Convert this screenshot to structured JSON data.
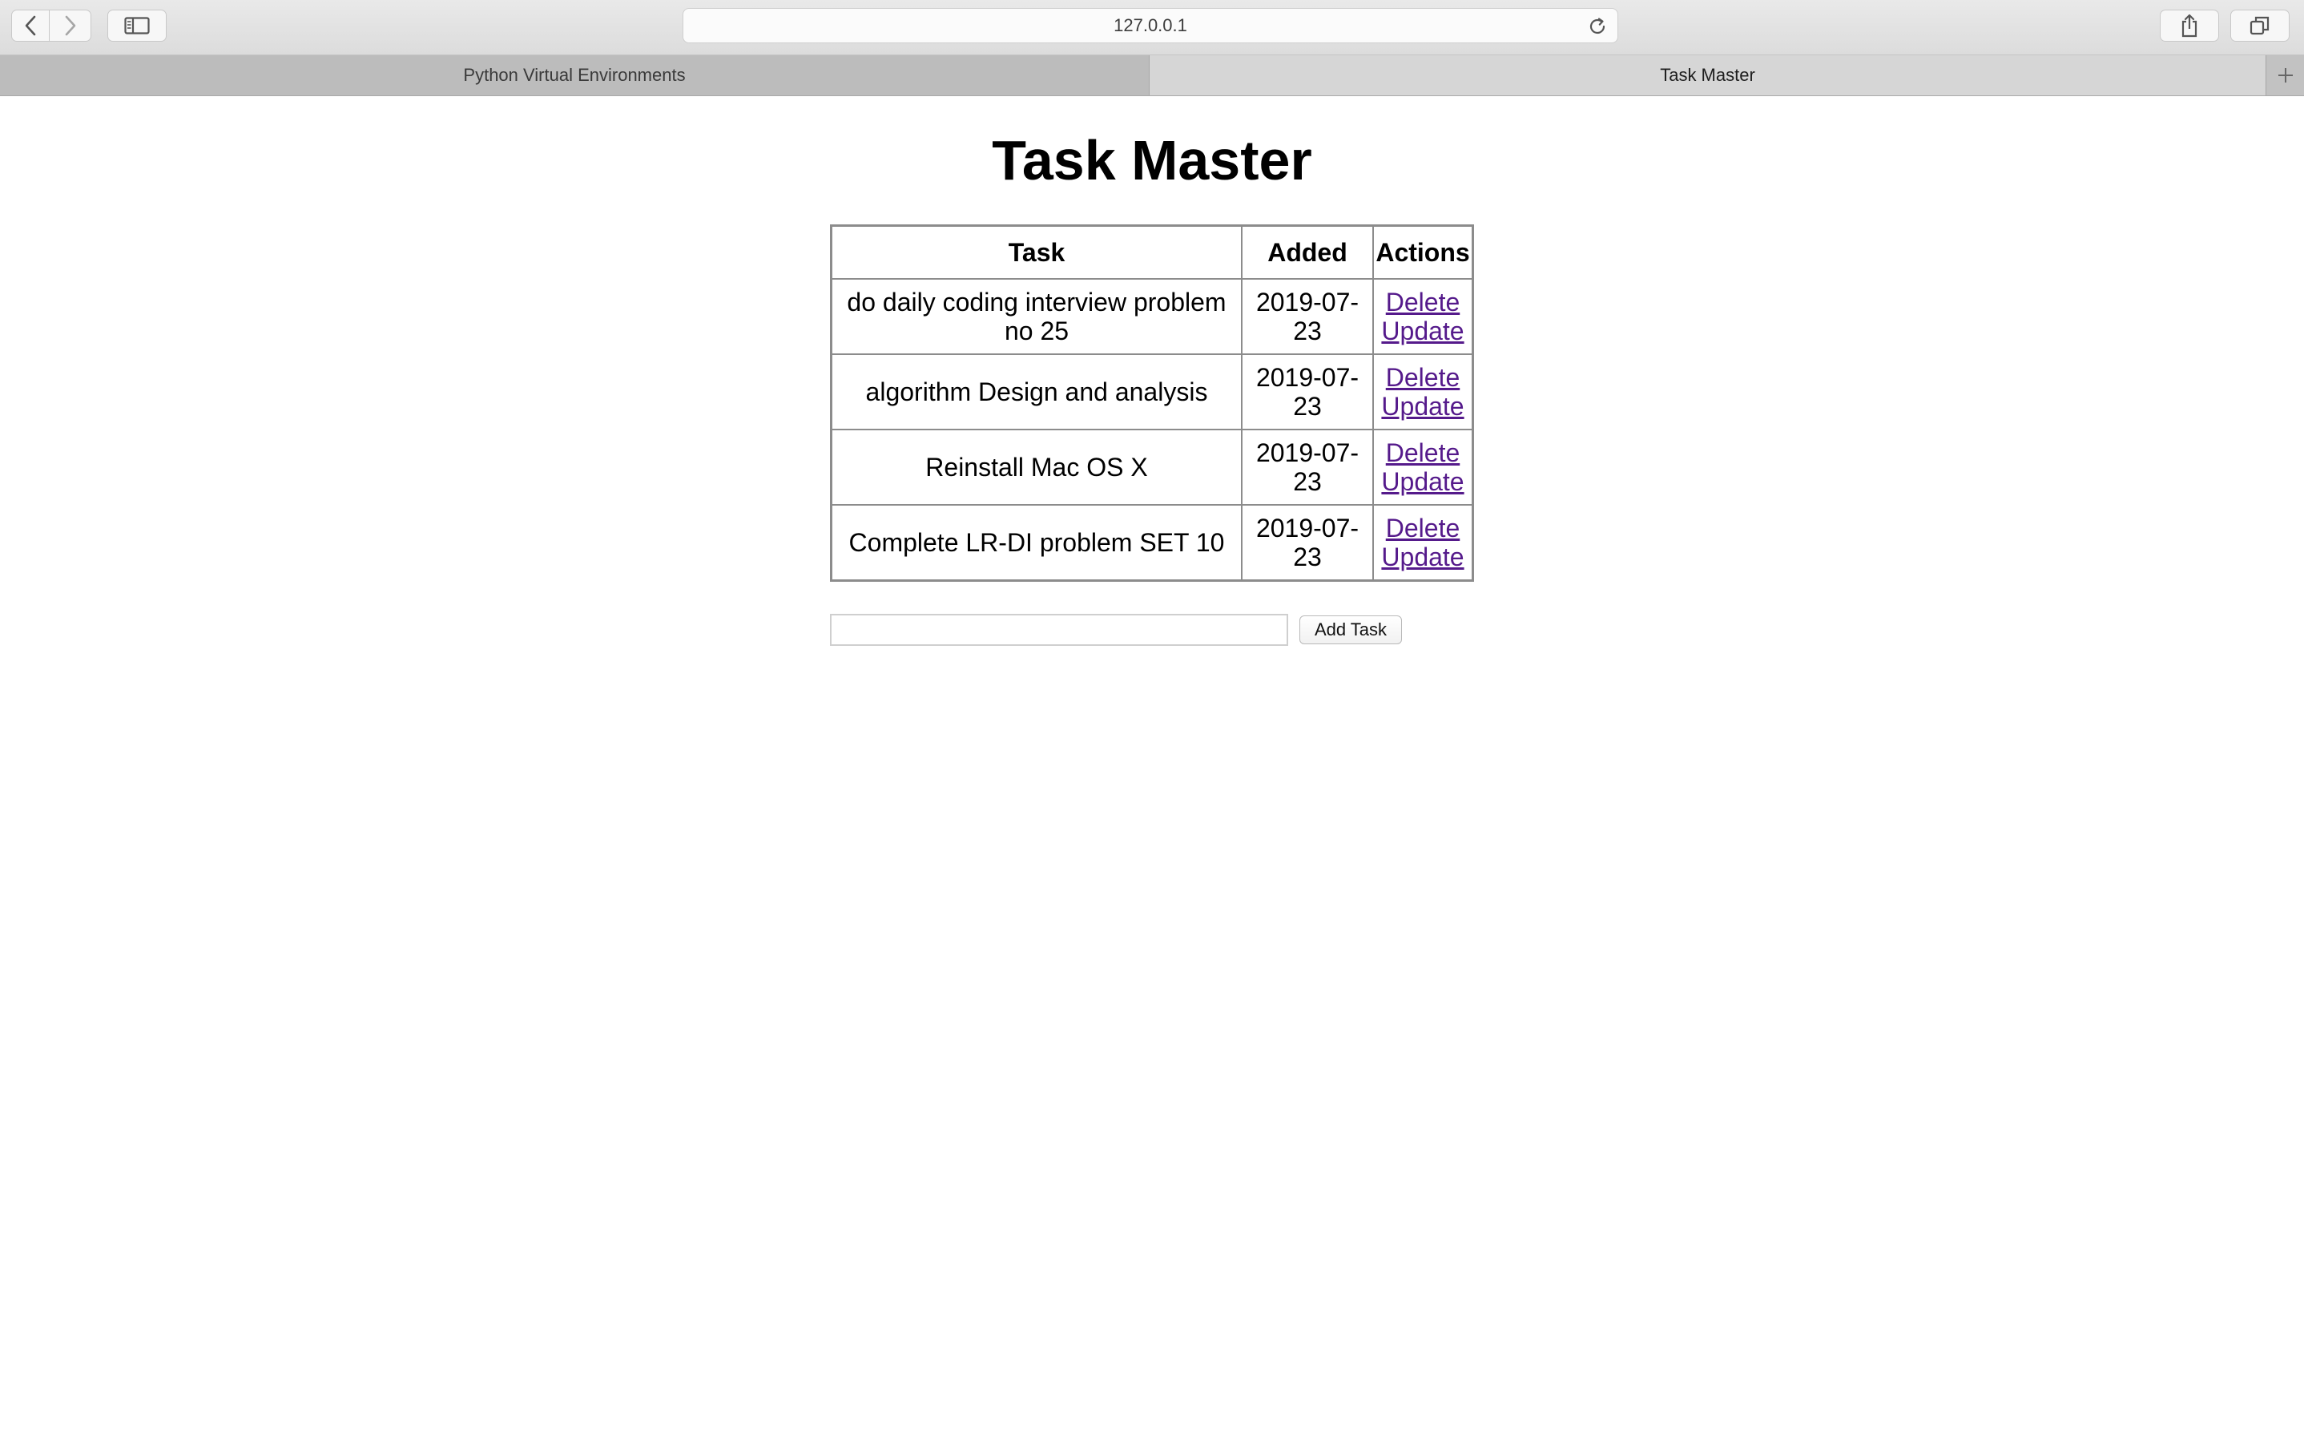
{
  "browser": {
    "address": "127.0.0.1",
    "tabs": [
      {
        "label": "Python Virtual Environments",
        "active": false
      },
      {
        "label": "Task Master",
        "active": true
      }
    ],
    "new_tab_label": "+"
  },
  "page": {
    "title": "Task Master",
    "table": {
      "headers": [
        "Task",
        "Added",
        "Actions"
      ],
      "rows": [
        {
          "task": "do daily coding interview problem no 25",
          "added": "2019-07-23",
          "delete": "Delete",
          "update": "Update"
        },
        {
          "task": "algorithm Design and analysis",
          "added": "2019-07-23",
          "delete": "Delete",
          "update": "Update"
        },
        {
          "task": "Reinstall Mac OS X",
          "added": "2019-07-23",
          "delete": "Delete",
          "update": "Update"
        },
        {
          "task": "Complete LR-DI problem SET 10",
          "added": "2019-07-23",
          "delete": "Delete",
          "update": "Update"
        }
      ]
    },
    "form": {
      "input_value": "",
      "button_label": "Add Task"
    }
  },
  "colors": {
    "link_visited": "#551a8b",
    "table_border": "#8c8c8c"
  }
}
